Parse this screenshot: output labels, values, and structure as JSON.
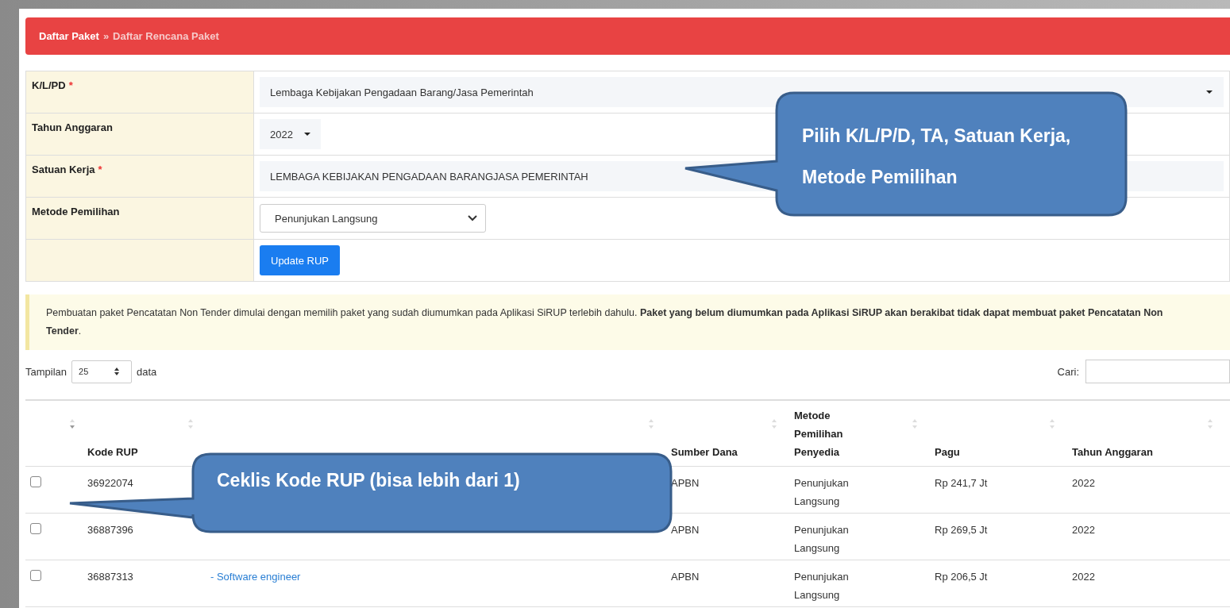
{
  "breadcrumb": {
    "parent": "Daftar Paket",
    "separator": "»",
    "current": "Daftar Rencana Paket"
  },
  "form": [
    {
      "label": "K/L/PD",
      "required_mark": "*",
      "kind": "wide-select",
      "value": "Lembaga Kebijakan Pengadaan Barang/Jasa Pemerintah"
    },
    {
      "label": "Tahun Anggaran",
      "kind": "small-select",
      "value": "2022"
    },
    {
      "label": "Satuan Kerja",
      "required_mark": "*",
      "kind": "text",
      "value": "LEMBAGA KEBIJAKAN PENGADAAN BARANGJASA PEMERINTAH"
    },
    {
      "label": "Metode Pemilihan",
      "kind": "dropdown",
      "value": "Penunjukan Langsung"
    },
    {
      "kind": "button",
      "value": "Update RUP"
    }
  ],
  "notice": "Pembuatan paket Pencatatan Non Tender dimulai dengan memilih paket yang sudah diumumkan pada Aplikasi SiRUP terlebih dahulu. **Paket yang belum diumumkan pada Aplikasi SiRUP akan berakibat tidak dapat membuat paket Pencatatan Non Tender**.",
  "length_control": {
    "label_before": "Tampilan",
    "value": "25",
    "label_after": "data"
  },
  "search": {
    "label": "Cari:"
  },
  "table": {
    "columns": [
      "",
      "Kode RUP",
      "",
      "Sumber Dana",
      "Metode Pemilihan Penyedia",
      "Pagu",
      "Tahun Anggaran"
    ],
    "rows": [
      {
        "checked": false,
        "kode": "36922074",
        "sumber": "APBN",
        "metode": "Penunjukan Langsung",
        "pagu": "Rp 241,7 Jt",
        "tahun": "2022"
      },
      {
        "checked": false,
        "kode": "36887396",
        "sumber": "APBN",
        "metode": "Penunjukan Langsung",
        "pagu": "Rp 269,5 Jt",
        "tahun": "2022"
      },
      {
        "checked": false,
        "kode": "36887313",
        "nama": "- Software engineer",
        "sumber": "APBN",
        "metode": "Penunjukan Langsung",
        "pagu": "Rp 206,5 Jt",
        "tahun": "2022"
      }
    ]
  },
  "callouts": [
    "Pilih K/L/P/D, TA, Satuan Kerja, Metode Pemilihan",
    "Ceklis Kode RUP (bisa lebih dari 1)"
  ]
}
